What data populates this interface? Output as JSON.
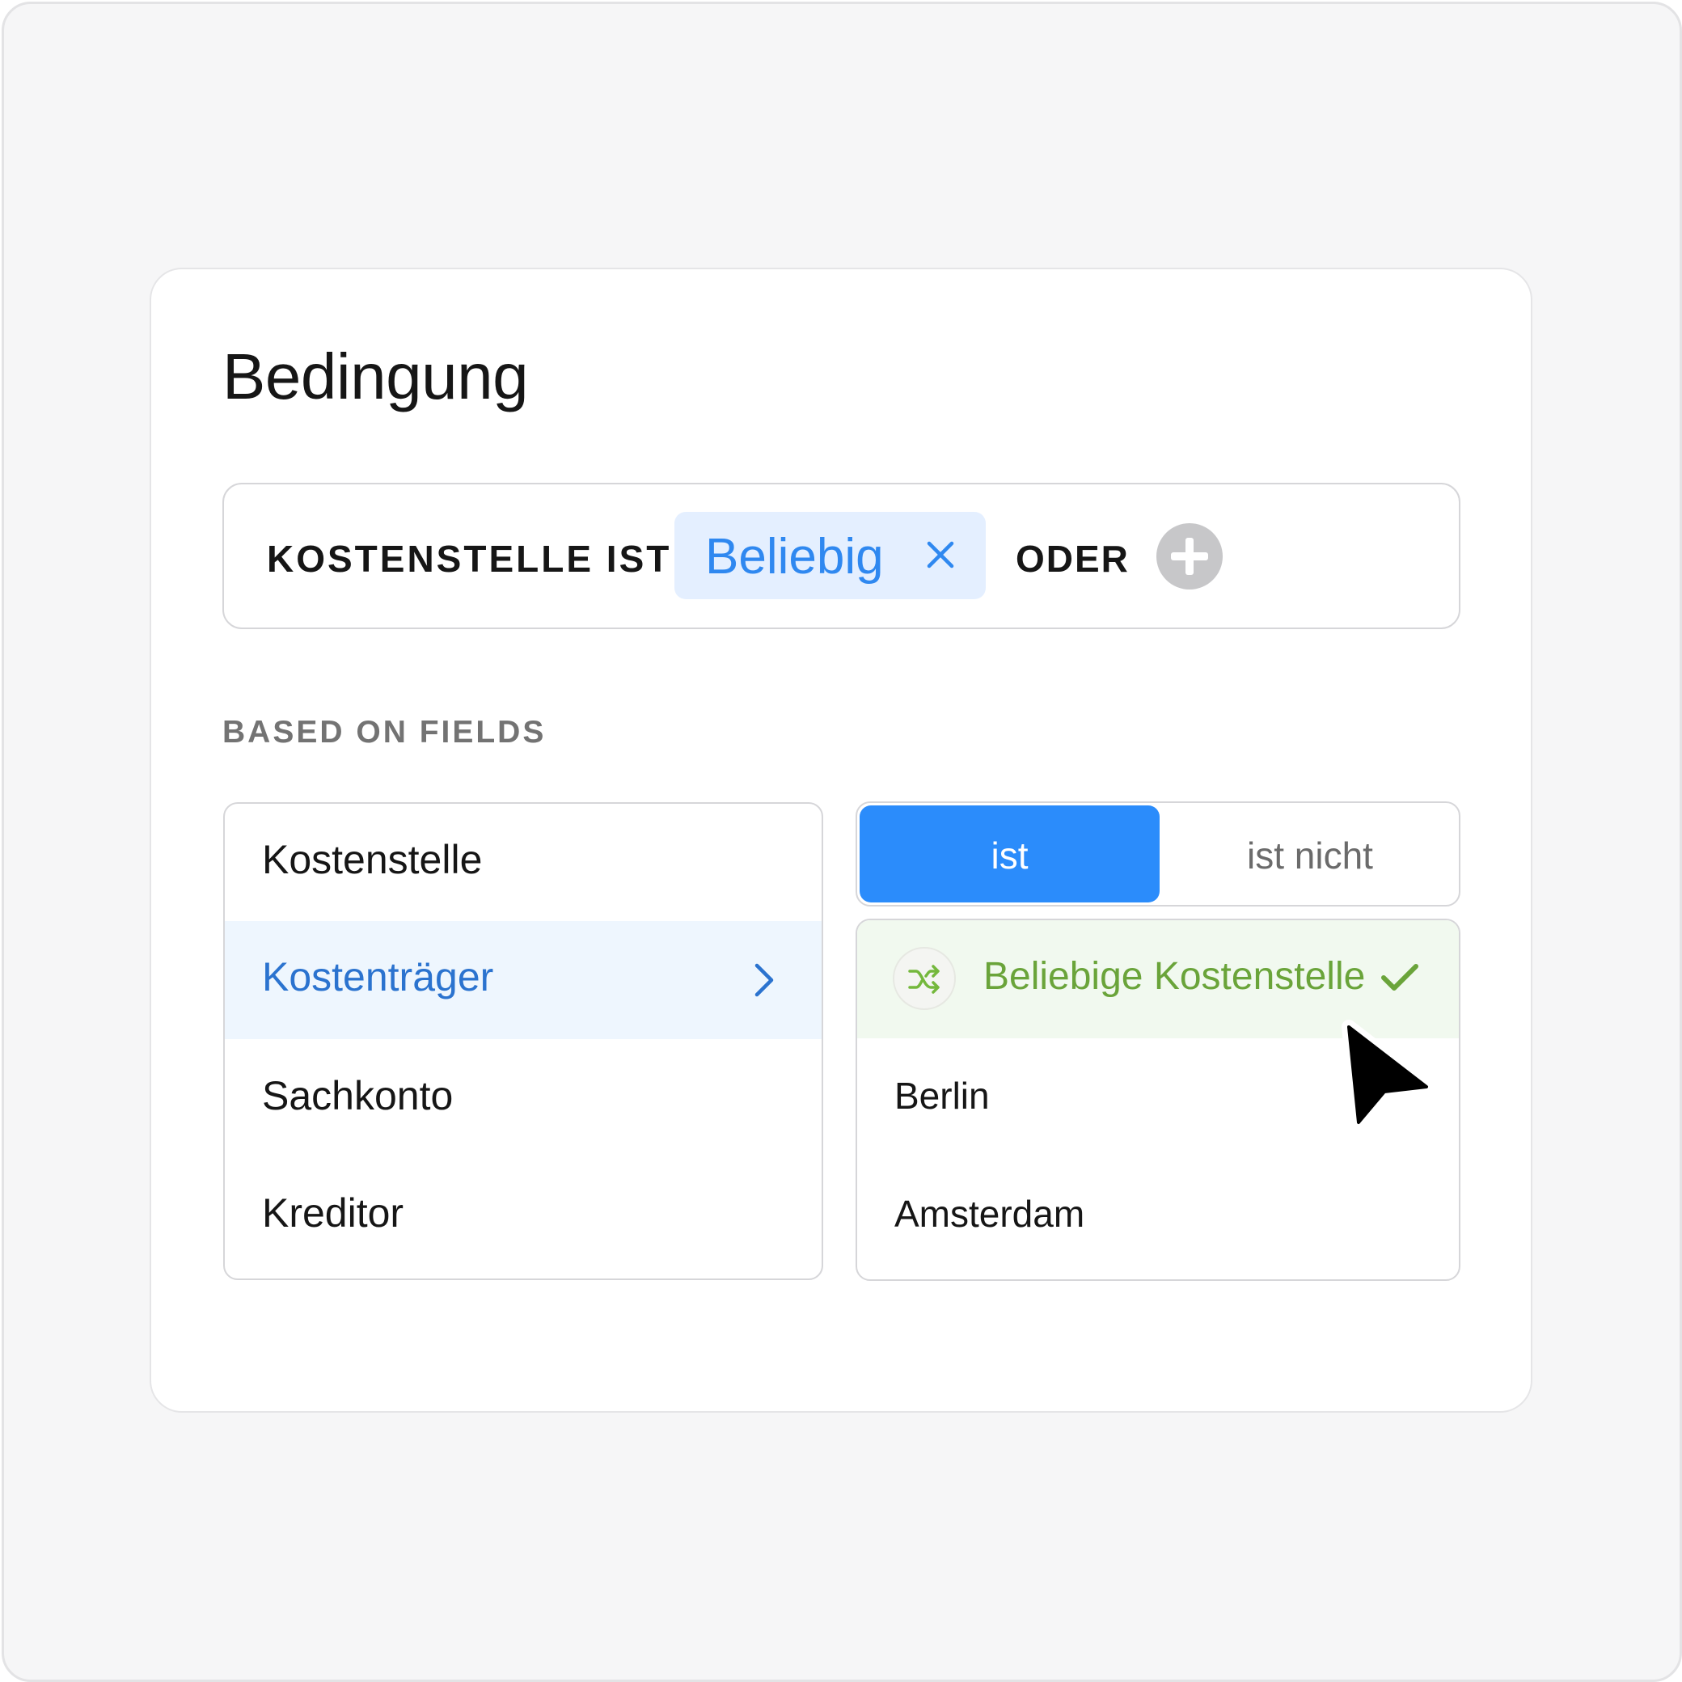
{
  "title": "Bedingung",
  "condition": {
    "label": "KOSTENSTELLE IST",
    "chip_label": "Beliebig",
    "connector": "ODER"
  },
  "section_label": "BASED ON FIELDS",
  "fields": [
    {
      "label": "Kostenstelle",
      "selected": false
    },
    {
      "label": "Kostenträger",
      "selected": true
    },
    {
      "label": "Sachkonto",
      "selected": false
    },
    {
      "label": "Kreditor",
      "selected": false
    }
  ],
  "operator_toggle": {
    "options": [
      "ist",
      "ist nicht"
    ],
    "selected": "ist"
  },
  "values": [
    {
      "label": "Beliebige Kostenstelle",
      "selected": true,
      "icon": "shuffle-icon"
    },
    {
      "label": "Berlin",
      "selected": false
    },
    {
      "label": "Amsterdam",
      "selected": false
    }
  ],
  "colors": {
    "accent_blue": "#2b8cfb",
    "chip_background": "#e4efff",
    "selected_green": "#6aa43a",
    "selected_field_background": "#eef6fe"
  }
}
